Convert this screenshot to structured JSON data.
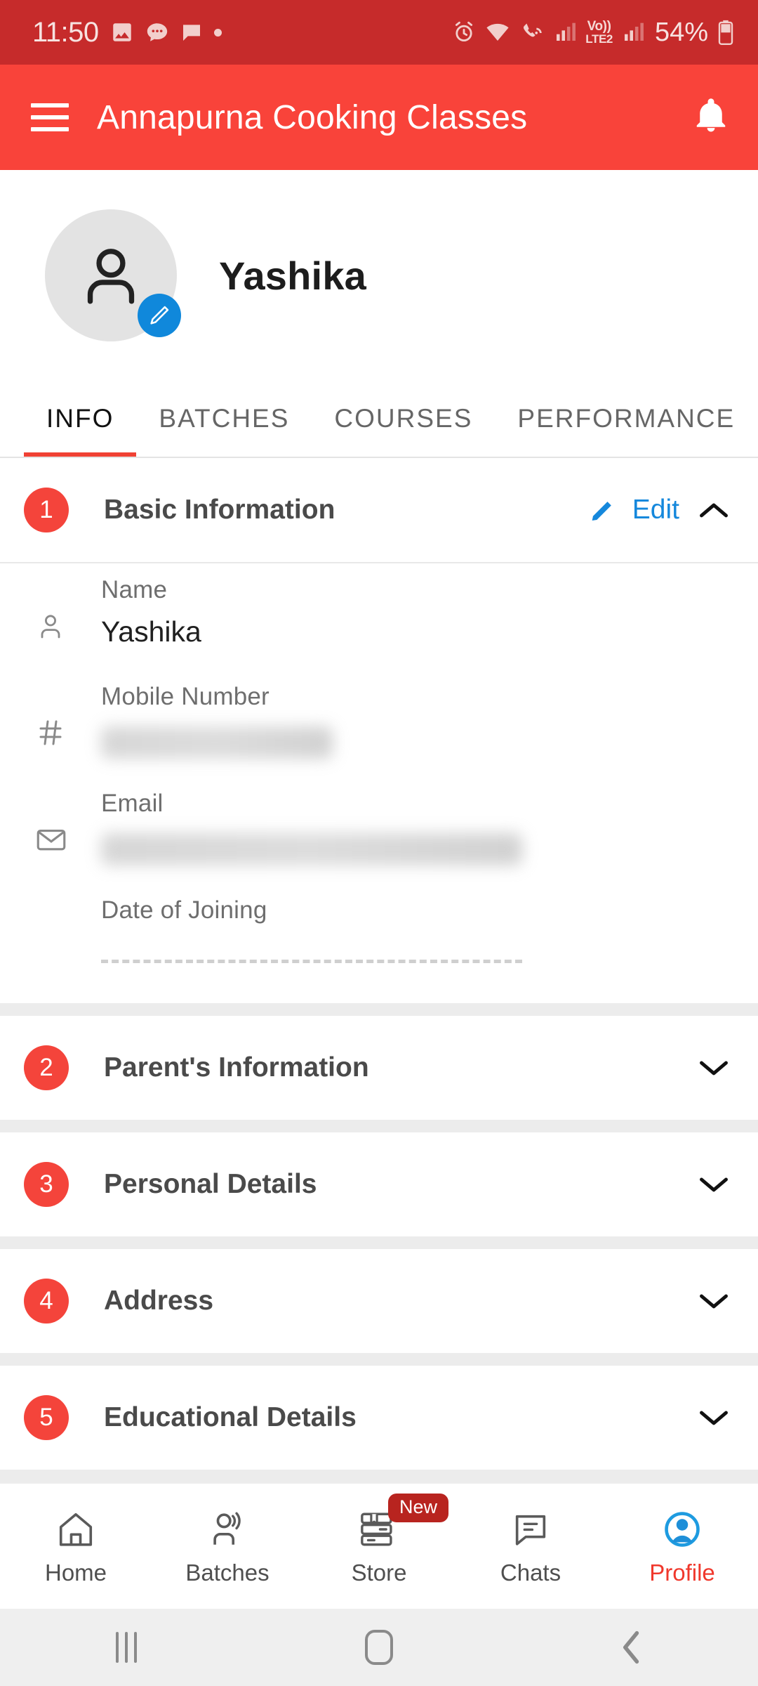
{
  "status_bar": {
    "time": "11:50",
    "left_icons": [
      "image-icon",
      "chat-dots-icon",
      "message-icon",
      "dot-icon"
    ],
    "right_icons": [
      "alarm-icon",
      "wifi-icon",
      "wifi-calling-icon",
      "signal-icon-1",
      "volte-icon",
      "signal-icon-2"
    ],
    "volte_top": "Vo))",
    "volte_bottom": "LTE2",
    "battery_percent": "54%"
  },
  "app_bar": {
    "title": "Annapurna Cooking Classes",
    "menu_icon": "hamburger-menu-icon",
    "notification_icon": "bell-icon"
  },
  "profile": {
    "name": "Yashika",
    "avatar_icon": "person-avatar-icon",
    "edit_badge_icon": "pencil-icon"
  },
  "tabs": [
    {
      "label": "INFO",
      "active": true
    },
    {
      "label": "BATCHES",
      "active": false
    },
    {
      "label": "COURSES",
      "active": false
    },
    {
      "label": "PERFORMANCE",
      "active": false
    }
  ],
  "sections": [
    {
      "number": "1",
      "title": "Basic Information",
      "edit_label": "Edit",
      "expanded": true
    },
    {
      "number": "2",
      "title": "Parent's Information",
      "expanded": false
    },
    {
      "number": "3",
      "title": "Personal Details",
      "expanded": false
    },
    {
      "number": "4",
      "title": "Address",
      "expanded": false
    },
    {
      "number": "5",
      "title": "Educational Details",
      "expanded": false
    }
  ],
  "basic_information": {
    "fields": [
      {
        "icon": "person-icon",
        "label": "Name",
        "value": "Yashika",
        "redacted": false
      },
      {
        "icon": "hash-icon",
        "label": "Mobile Number",
        "value": "",
        "redacted": true
      },
      {
        "icon": "envelope-icon",
        "label": "Email",
        "value": "",
        "redacted": true
      },
      {
        "icon": "none",
        "label": "Date of Joining",
        "value": "",
        "redacted": false,
        "empty_dashed": true
      }
    ]
  },
  "bottom_nav": [
    {
      "label": "Home",
      "icon": "home-icon",
      "active": false,
      "badge": ""
    },
    {
      "label": "Batches",
      "icon": "people-icon",
      "active": false,
      "badge": ""
    },
    {
      "label": "Store",
      "icon": "books-icon",
      "active": false,
      "badge": "New"
    },
    {
      "label": "Chats",
      "icon": "chat-bubble-icon",
      "active": false,
      "badge": ""
    },
    {
      "label": "Profile",
      "icon": "profile-person-icon",
      "active": true,
      "badge": ""
    }
  ],
  "android_nav": {
    "recents_icon": "recents-icon",
    "home_icon": "home-square-icon",
    "back_icon": "back-chevron-icon"
  },
  "colors": {
    "status_bar": "#C62B2B",
    "app_bar": "#F9433A",
    "accent_red": "#F4443B",
    "link_blue": "#1588DC",
    "badge_blue": "#1088DB",
    "page_bg": "#ECECEC"
  }
}
